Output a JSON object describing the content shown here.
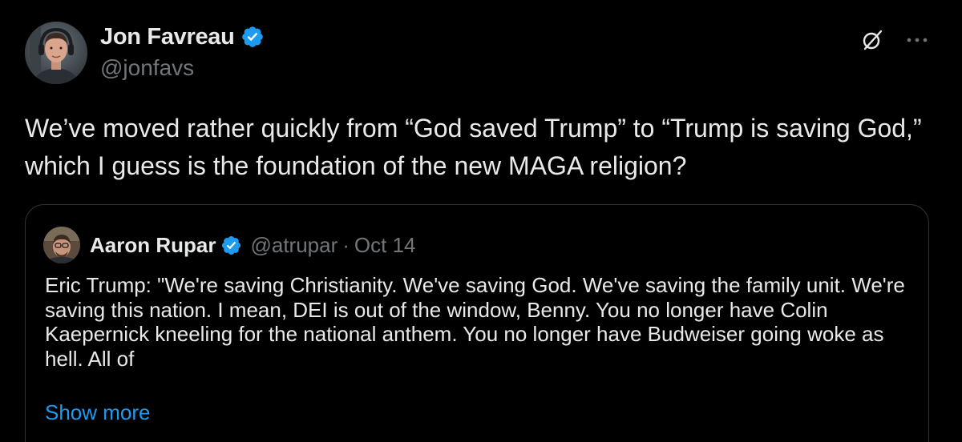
{
  "tweet": {
    "author": {
      "name": "Jon Favreau",
      "handle": "@jonfavs",
      "verified": true
    },
    "text": "We’ve moved rather quickly from “God saved Trump” to “Trump is saving God,” which I guess is the foundation of the new MAGA religion?",
    "actions": {
      "grok_icon": "grok-icon",
      "more_icon": "more-icon"
    }
  },
  "quoted_tweet": {
    "author": {
      "name": "Aaron Rupar",
      "handle": "@atrupar",
      "verified": true
    },
    "separator": "·",
    "date": "Oct 14",
    "text": "Eric Trump: \"We're saving Christianity. We've saving God. We've saving the family unit. We're saving this nation. I mean, DEI is out of the window, Benny. You no longer have Colin Kaepernick kneeling for the national anthem. You no longer have Budweiser going woke as hell. All of",
    "show_more_label": "Show more"
  },
  "colors": {
    "background": "#000000",
    "primary_text": "#e7e9ea",
    "secondary_text": "#71767b",
    "accent": "#1d9bf0",
    "border": "#2f3336"
  }
}
